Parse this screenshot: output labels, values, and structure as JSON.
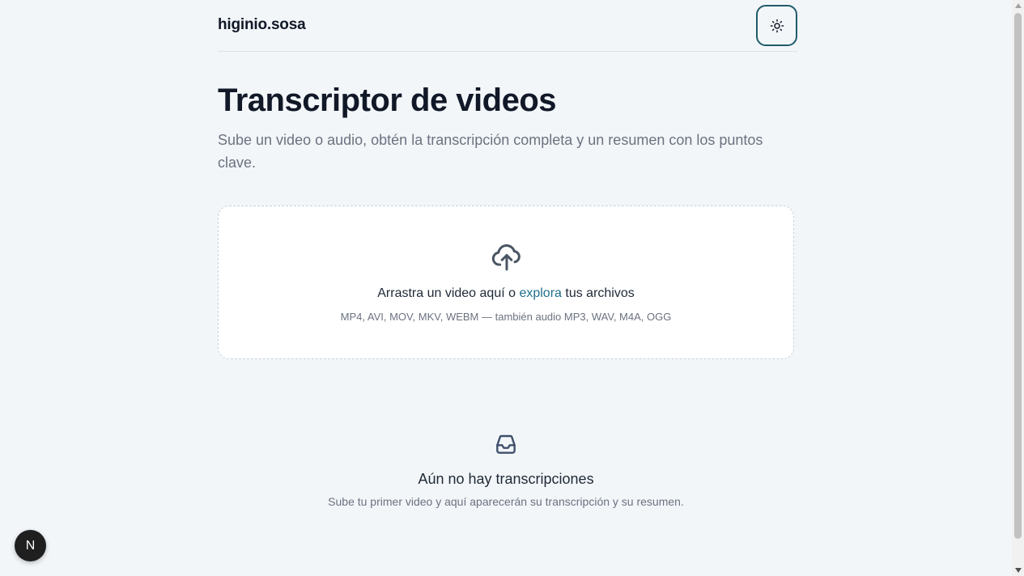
{
  "header": {
    "brand": "higinio.sosa",
    "theme_toggle_icon": "sun-icon"
  },
  "main": {
    "title": "Transcriptor de videos",
    "subtitle": "Sube un video o audio, obtén la transcripción completa y un resumen con los puntos clave."
  },
  "dropzone": {
    "icon": "cloud-upload-icon",
    "text_before": "Arrastra un video aquí o ",
    "link_text": "explora",
    "text_after": " tus archivos",
    "formats": "MP4, AVI, MOV, MKV, WEBM — también audio MP3, WAV, M4A, OGG"
  },
  "empty_state": {
    "icon": "inbox-icon",
    "title": "Aún no hay transcripciones",
    "description": "Sube tu primer video y aquí aparecerán su transcripción y su resumen."
  },
  "floating_badge": {
    "label": "N"
  },
  "colors": {
    "background": "#f3f6f9",
    "accent": "#1f5b6b",
    "link": "#1f6f8b",
    "text_primary": "#111827",
    "text_muted": "#6b7280"
  }
}
